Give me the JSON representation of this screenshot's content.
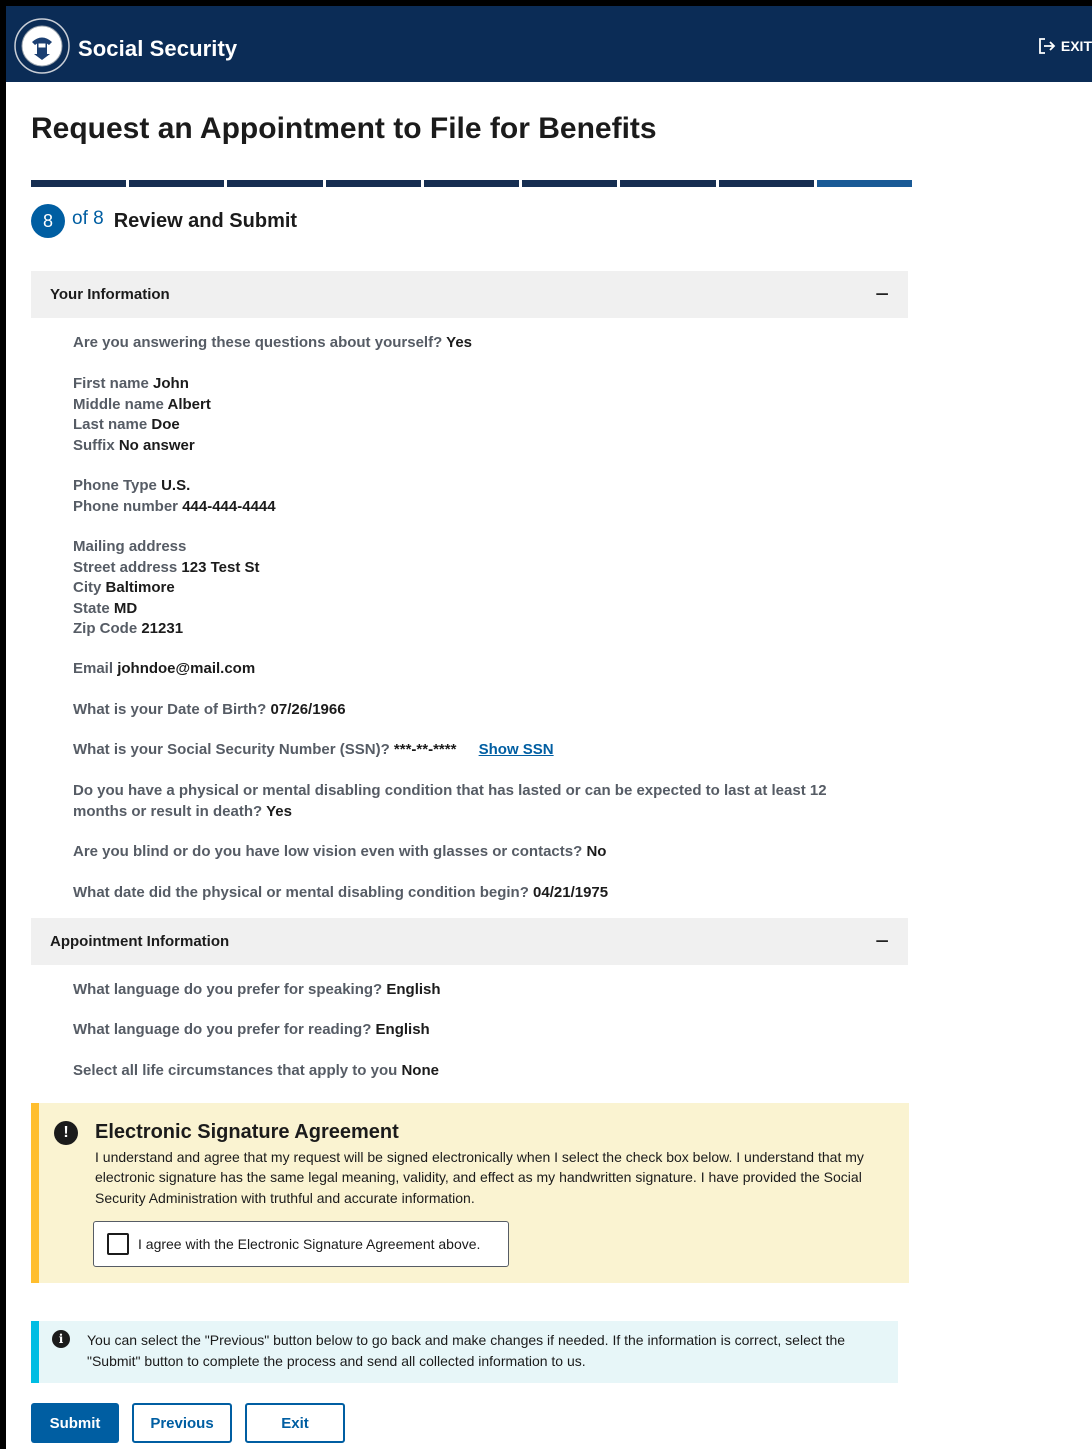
{
  "header": {
    "brand": "Social Security",
    "exit_label": "EXIT"
  },
  "page": {
    "title": "Request an Appointment to File for Benefits",
    "progress": {
      "current_step": 8,
      "total_steps": 8
    },
    "step_number": "8",
    "step_of": "of 8",
    "step_title": "Review and Submit"
  },
  "your_information": {
    "heading": "Your Information",
    "about_yourself_q": "Are you answering these questions about yourself?",
    "about_yourself_a": "Yes",
    "first_name_q": "First name",
    "first_name_a": "John",
    "middle_name_q": "Middle name",
    "middle_name_a": "Albert",
    "last_name_q": "Last name",
    "last_name_a": "Doe",
    "suffix_q": "Suffix",
    "suffix_a": "No answer",
    "phone_type_q": "Phone Type",
    "phone_type_a": "U.S.",
    "phone_number_q": "Phone number",
    "phone_number_a": "444-444-4444",
    "mailing_address_label": "Mailing address",
    "street_q": "Street address",
    "street_a": "123 Test St",
    "city_q": "City",
    "city_a": "Baltimore",
    "state_q": "State",
    "state_a": "MD",
    "zip_q": "Zip Code",
    "zip_a": "21231",
    "email_q": "Email",
    "email_a": "johndoe@mail.com",
    "dob_q": "What is your Date of Birth?",
    "dob_a": "07/26/1966",
    "ssn_q": "What is your Social Security Number (SSN)?",
    "ssn_a": "***-**-****",
    "show_ssn_label": "Show SSN",
    "disabling_q": "Do you have a physical or mental disabling condition that has lasted or can be expected to last at least 12 months or result in death?",
    "disabling_a": "Yes",
    "blind_q": "Are you blind or do you have low vision even with glasses or contacts?",
    "blind_a": "No",
    "condition_date_q": "What date did the physical or mental disabling condition begin?",
    "condition_date_a": "04/21/1975"
  },
  "appointment_information": {
    "heading": "Appointment Information",
    "speaking_q": "What language do you prefer for speaking?",
    "speaking_a": "English",
    "reading_q": "What language do you prefer for reading?",
    "reading_a": "English",
    "circumstances_q": "Select all life circumstances that apply to you",
    "circumstances_a": "None"
  },
  "esignature": {
    "title": "Electronic Signature Agreement",
    "body": "I understand and agree that my request will be signed electronically when I select the check box below. I understand that my electronic signature has the same legal meaning, validity, and effect as my handwritten signature. I have provided the Social Security Administration with truthful and accurate information.",
    "checkbox_label": "I agree with the Electronic Signature Agreement above.",
    "checked": false
  },
  "info_alert": {
    "text": "You can select the \"Previous\" button below to go back and make changes if needed. If the information is correct, select the \"Submit\" button to complete the process and send all collected information to us."
  },
  "buttons": {
    "submit": "Submit",
    "previous": "Previous",
    "exit": "Exit"
  },
  "colors": {
    "header_bg": "#0b2c56",
    "primary": "#005ea2",
    "warning_bg": "#faf3d1",
    "warning_border": "#ffbe2e",
    "info_bg": "#e7f6f8",
    "info_border": "#00bde3"
  },
  "icons": {
    "seal": "ssa-seal-icon",
    "exit": "exit-arrow-icon",
    "collapse": "minus-icon",
    "alert": "exclamation-icon",
    "info": "info-icon"
  }
}
